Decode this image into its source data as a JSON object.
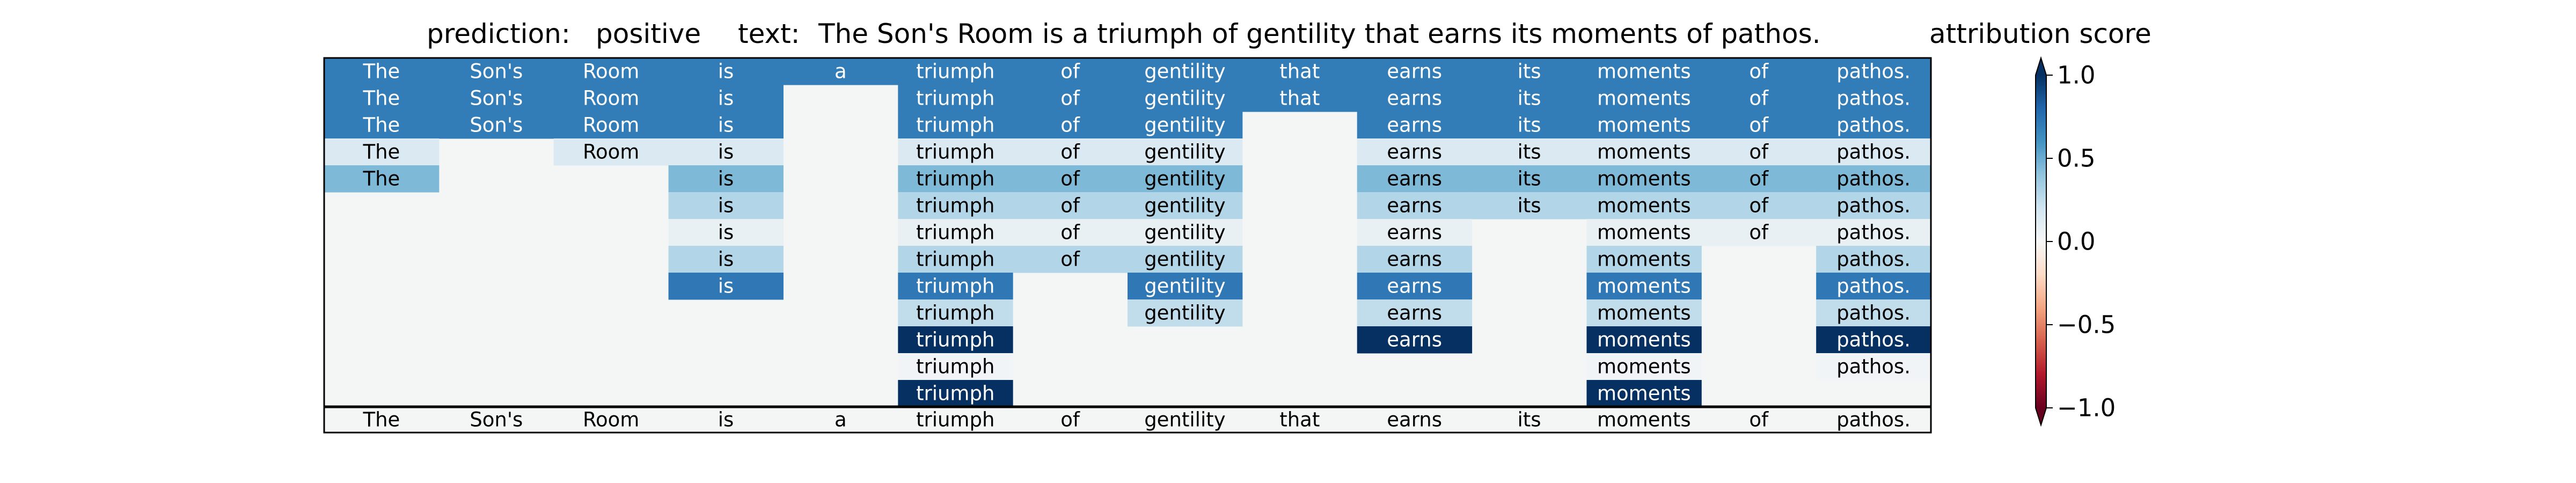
{
  "header": {
    "prediction_label": "prediction:",
    "prediction_value": "positive",
    "text_label": "text:",
    "text_value": "The Son's Room is a triumph of gentility that earns its moments of pathos.",
    "colorbar_title": "attribution score"
  },
  "chart_data": {
    "type": "heatmap",
    "tokens": [
      "The",
      "Son's",
      "Room",
      "is",
      "a",
      "triumph",
      "of",
      "gentility",
      "that",
      "earns",
      "its",
      "moments",
      "of",
      "pathos."
    ],
    "rows": [
      {
        "tokens": [
          0,
          1,
          2,
          3,
          4,
          5,
          6,
          7,
          8,
          9,
          10,
          11,
          12,
          13
        ],
        "values": [
          0.7,
          0.7,
          0.7,
          0.7,
          0.7,
          0.7,
          0.7,
          0.7,
          0.7,
          0.7,
          0.7,
          0.7,
          0.7,
          0.7
        ]
      },
      {
        "tokens": [
          0,
          1,
          2,
          3,
          5,
          6,
          7,
          8,
          9,
          10,
          11,
          12,
          13
        ],
        "values": [
          0.7,
          0.7,
          0.7,
          0.7,
          0.7,
          0.7,
          0.7,
          0.7,
          0.7,
          0.7,
          0.7,
          0.7,
          0.7
        ]
      },
      {
        "tokens": [
          0,
          1,
          2,
          3,
          5,
          6,
          7,
          9,
          10,
          11,
          12,
          13
        ],
        "values": [
          0.7,
          0.7,
          0.7,
          0.7,
          0.7,
          0.7,
          0.7,
          0.7,
          0.7,
          0.7,
          0.7,
          0.7
        ]
      },
      {
        "tokens": [
          0,
          2,
          3,
          5,
          6,
          7,
          9,
          10,
          11,
          12,
          13
        ],
        "values": [
          0.15,
          0.15,
          0.15,
          0.15,
          0.15,
          0.15,
          0.15,
          0.15,
          0.15,
          0.15,
          0.15
        ]
      },
      {
        "tokens": [
          0,
          3,
          5,
          6,
          7,
          9,
          10,
          11,
          12,
          13
        ],
        "values": [
          0.45,
          0.45,
          0.45,
          0.45,
          0.45,
          0.45,
          0.45,
          0.45,
          0.45,
          0.45
        ]
      },
      {
        "tokens": [
          3,
          5,
          6,
          7,
          9,
          10,
          11,
          12,
          13
        ],
        "values": [
          0.3,
          0.3,
          0.3,
          0.3,
          0.3,
          0.3,
          0.3,
          0.3,
          0.3
        ]
      },
      {
        "tokens": [
          3,
          5,
          6,
          7,
          9,
          11,
          12,
          13
        ],
        "values": [
          0.08,
          0.08,
          0.08,
          0.08,
          0.08,
          0.08,
          0.08,
          0.08
        ]
      },
      {
        "tokens": [
          3,
          5,
          6,
          7,
          9,
          11,
          13
        ],
        "values": [
          0.3,
          0.3,
          0.3,
          0.3,
          0.3,
          0.3,
          0.3
        ]
      },
      {
        "tokens": [
          3,
          5,
          7,
          9,
          11,
          13
        ],
        "values": [
          0.72,
          0.72,
          0.72,
          0.72,
          0.72,
          0.72
        ]
      },
      {
        "tokens": [
          5,
          7,
          9,
          11,
          13
        ],
        "values": [
          0.25,
          0.25,
          0.25,
          0.25,
          0.25
        ]
      },
      {
        "tokens": [
          5,
          9,
          11,
          13
        ],
        "values": [
          1.0,
          1.0,
          1.0,
          1.0
        ]
      },
      {
        "tokens": [
          5,
          11,
          13
        ],
        "values": [
          0.03,
          0.03,
          0.03
        ]
      },
      {
        "tokens": [
          5,
          11
        ],
        "values": [
          1.0,
          1.0
        ]
      }
    ],
    "reference_row": [
      "The",
      "Son's",
      "Room",
      "is",
      "a",
      "triumph",
      "of",
      "gentility",
      "that",
      "earns",
      "its",
      "moments",
      "of",
      "pathos."
    ],
    "colorbar": {
      "colormap": "RdBu",
      "min": -1.0,
      "max": 1.0,
      "extend": "both",
      "ticks": [
        1.0,
        0.5,
        0.0,
        -0.5,
        -1.0
      ],
      "tick_labels": [
        "1.0",
        "0.5",
        "0.0",
        "−0.5",
        "−1.0"
      ]
    }
  }
}
